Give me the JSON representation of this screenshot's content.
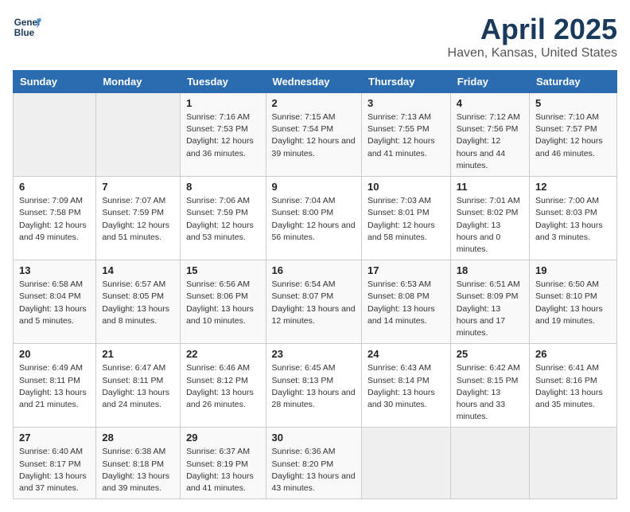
{
  "logo": {
    "line1": "General",
    "line2": "Blue"
  },
  "title": "April 2025",
  "subtitle": "Haven, Kansas, United States",
  "days_of_week": [
    "Sunday",
    "Monday",
    "Tuesday",
    "Wednesday",
    "Thursday",
    "Friday",
    "Saturday"
  ],
  "weeks": [
    [
      {
        "day": "",
        "sunrise": "",
        "sunset": "",
        "daylight": ""
      },
      {
        "day": "",
        "sunrise": "",
        "sunset": "",
        "daylight": ""
      },
      {
        "day": "1",
        "sunrise": "Sunrise: 7:16 AM",
        "sunset": "Sunset: 7:53 PM",
        "daylight": "Daylight: 12 hours and 36 minutes."
      },
      {
        "day": "2",
        "sunrise": "Sunrise: 7:15 AM",
        "sunset": "Sunset: 7:54 PM",
        "daylight": "Daylight: 12 hours and 39 minutes."
      },
      {
        "day": "3",
        "sunrise": "Sunrise: 7:13 AM",
        "sunset": "Sunset: 7:55 PM",
        "daylight": "Daylight: 12 hours and 41 minutes."
      },
      {
        "day": "4",
        "sunrise": "Sunrise: 7:12 AM",
        "sunset": "Sunset: 7:56 PM",
        "daylight": "Daylight: 12 hours and 44 minutes."
      },
      {
        "day": "5",
        "sunrise": "Sunrise: 7:10 AM",
        "sunset": "Sunset: 7:57 PM",
        "daylight": "Daylight: 12 hours and 46 minutes."
      }
    ],
    [
      {
        "day": "6",
        "sunrise": "Sunrise: 7:09 AM",
        "sunset": "Sunset: 7:58 PM",
        "daylight": "Daylight: 12 hours and 49 minutes."
      },
      {
        "day": "7",
        "sunrise": "Sunrise: 7:07 AM",
        "sunset": "Sunset: 7:59 PM",
        "daylight": "Daylight: 12 hours and 51 minutes."
      },
      {
        "day": "8",
        "sunrise": "Sunrise: 7:06 AM",
        "sunset": "Sunset: 7:59 PM",
        "daylight": "Daylight: 12 hours and 53 minutes."
      },
      {
        "day": "9",
        "sunrise": "Sunrise: 7:04 AM",
        "sunset": "Sunset: 8:00 PM",
        "daylight": "Daylight: 12 hours and 56 minutes."
      },
      {
        "day": "10",
        "sunrise": "Sunrise: 7:03 AM",
        "sunset": "Sunset: 8:01 PM",
        "daylight": "Daylight: 12 hours and 58 minutes."
      },
      {
        "day": "11",
        "sunrise": "Sunrise: 7:01 AM",
        "sunset": "Sunset: 8:02 PM",
        "daylight": "Daylight: 13 hours and 0 minutes."
      },
      {
        "day": "12",
        "sunrise": "Sunrise: 7:00 AM",
        "sunset": "Sunset: 8:03 PM",
        "daylight": "Daylight: 13 hours and 3 minutes."
      }
    ],
    [
      {
        "day": "13",
        "sunrise": "Sunrise: 6:58 AM",
        "sunset": "Sunset: 8:04 PM",
        "daylight": "Daylight: 13 hours and 5 minutes."
      },
      {
        "day": "14",
        "sunrise": "Sunrise: 6:57 AM",
        "sunset": "Sunset: 8:05 PM",
        "daylight": "Daylight: 13 hours and 8 minutes."
      },
      {
        "day": "15",
        "sunrise": "Sunrise: 6:56 AM",
        "sunset": "Sunset: 8:06 PM",
        "daylight": "Daylight: 13 hours and 10 minutes."
      },
      {
        "day": "16",
        "sunrise": "Sunrise: 6:54 AM",
        "sunset": "Sunset: 8:07 PM",
        "daylight": "Daylight: 13 hours and 12 minutes."
      },
      {
        "day": "17",
        "sunrise": "Sunrise: 6:53 AM",
        "sunset": "Sunset: 8:08 PM",
        "daylight": "Daylight: 13 hours and 14 minutes."
      },
      {
        "day": "18",
        "sunrise": "Sunrise: 6:51 AM",
        "sunset": "Sunset: 8:09 PM",
        "daylight": "Daylight: 13 hours and 17 minutes."
      },
      {
        "day": "19",
        "sunrise": "Sunrise: 6:50 AM",
        "sunset": "Sunset: 8:10 PM",
        "daylight": "Daylight: 13 hours and 19 minutes."
      }
    ],
    [
      {
        "day": "20",
        "sunrise": "Sunrise: 6:49 AM",
        "sunset": "Sunset: 8:11 PM",
        "daylight": "Daylight: 13 hours and 21 minutes."
      },
      {
        "day": "21",
        "sunrise": "Sunrise: 6:47 AM",
        "sunset": "Sunset: 8:11 PM",
        "daylight": "Daylight: 13 hours and 24 minutes."
      },
      {
        "day": "22",
        "sunrise": "Sunrise: 6:46 AM",
        "sunset": "Sunset: 8:12 PM",
        "daylight": "Daylight: 13 hours and 26 minutes."
      },
      {
        "day": "23",
        "sunrise": "Sunrise: 6:45 AM",
        "sunset": "Sunset: 8:13 PM",
        "daylight": "Daylight: 13 hours and 28 minutes."
      },
      {
        "day": "24",
        "sunrise": "Sunrise: 6:43 AM",
        "sunset": "Sunset: 8:14 PM",
        "daylight": "Daylight: 13 hours and 30 minutes."
      },
      {
        "day": "25",
        "sunrise": "Sunrise: 6:42 AM",
        "sunset": "Sunset: 8:15 PM",
        "daylight": "Daylight: 13 hours and 33 minutes."
      },
      {
        "day": "26",
        "sunrise": "Sunrise: 6:41 AM",
        "sunset": "Sunset: 8:16 PM",
        "daylight": "Daylight: 13 hours and 35 minutes."
      }
    ],
    [
      {
        "day": "27",
        "sunrise": "Sunrise: 6:40 AM",
        "sunset": "Sunset: 8:17 PM",
        "daylight": "Daylight: 13 hours and 37 minutes."
      },
      {
        "day": "28",
        "sunrise": "Sunrise: 6:38 AM",
        "sunset": "Sunset: 8:18 PM",
        "daylight": "Daylight: 13 hours and 39 minutes."
      },
      {
        "day": "29",
        "sunrise": "Sunrise: 6:37 AM",
        "sunset": "Sunset: 8:19 PM",
        "daylight": "Daylight: 13 hours and 41 minutes."
      },
      {
        "day": "30",
        "sunrise": "Sunrise: 6:36 AM",
        "sunset": "Sunset: 8:20 PM",
        "daylight": "Daylight: 13 hours and 43 minutes."
      },
      {
        "day": "",
        "sunrise": "",
        "sunset": "",
        "daylight": ""
      },
      {
        "day": "",
        "sunrise": "",
        "sunset": "",
        "daylight": ""
      },
      {
        "day": "",
        "sunrise": "",
        "sunset": "",
        "daylight": ""
      }
    ]
  ]
}
